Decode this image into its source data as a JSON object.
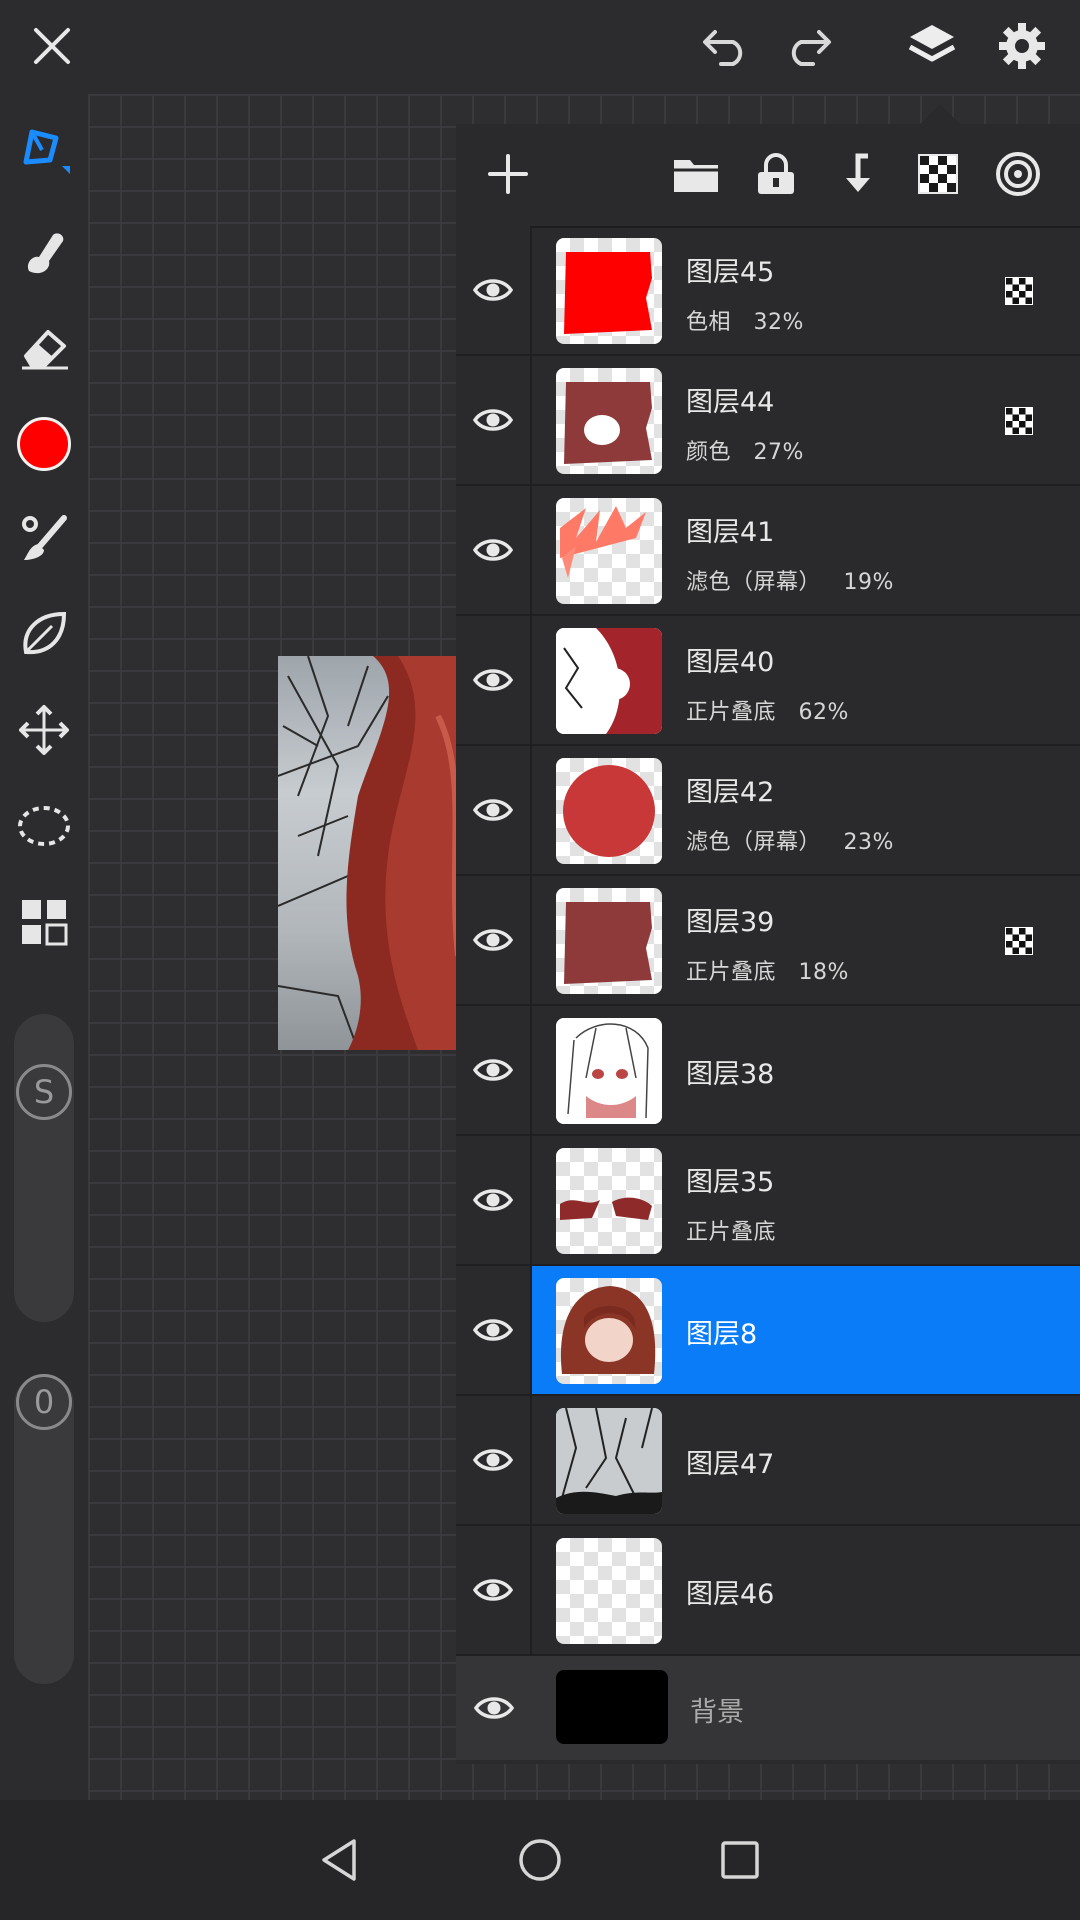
{
  "app": {
    "accent_color": "#0a7cf8",
    "current_color": "#ff0000"
  },
  "top_bar": {
    "icons": [
      "close-icon",
      "undo-icon",
      "redo-icon",
      "layers-icon",
      "settings-icon"
    ]
  },
  "tools": {
    "items": [
      "pen-icon",
      "smudge-icon",
      "eraser-icon",
      "color-swatch",
      "brush-icon",
      "leaf-shape-icon",
      "move-transform-icon",
      "lasso-select-icon",
      "layout-grid-icon"
    ],
    "size_slider_label": "S",
    "opacity_slider_label": "0"
  },
  "layer_panel": {
    "toolbar_icons": [
      "add-icon",
      "folder-icon",
      "lock-icon",
      "merge-down-icon",
      "checker-icon",
      "target-icon"
    ],
    "layers": [
      {
        "name": "图层45",
        "mode": "色相",
        "opacity": "32%",
        "clipped": true
      },
      {
        "name": "图层44",
        "mode": "颜色",
        "opacity": "27%",
        "clipped": true
      },
      {
        "name": "图层41",
        "mode": "滤色（屏幕）",
        "opacity": "19%",
        "clipped": false
      },
      {
        "name": "图层40",
        "mode": "正片叠底",
        "opacity": "62%",
        "clipped": false
      },
      {
        "name": "图层42",
        "mode": "滤色（屏幕）",
        "opacity": "23%",
        "clipped": false
      },
      {
        "name": "图层39",
        "mode": "正片叠底",
        "opacity": "18%",
        "clipped": true
      },
      {
        "name": "图层38",
        "mode": "",
        "opacity": "",
        "clipped": false
      },
      {
        "name": "图层35",
        "mode": "正片叠底",
        "opacity": "",
        "clipped": false
      },
      {
        "name": "图层8",
        "mode": "",
        "opacity": "",
        "clipped": false,
        "selected": true
      },
      {
        "name": "图层47",
        "mode": "",
        "opacity": "",
        "clipped": false
      },
      {
        "name": "图层46",
        "mode": "",
        "opacity": "",
        "clipped": false
      }
    ],
    "background_layer": {
      "name": "背景"
    }
  },
  "nav_bar": {
    "icons": [
      "back-icon",
      "home-icon",
      "recents-icon"
    ]
  }
}
